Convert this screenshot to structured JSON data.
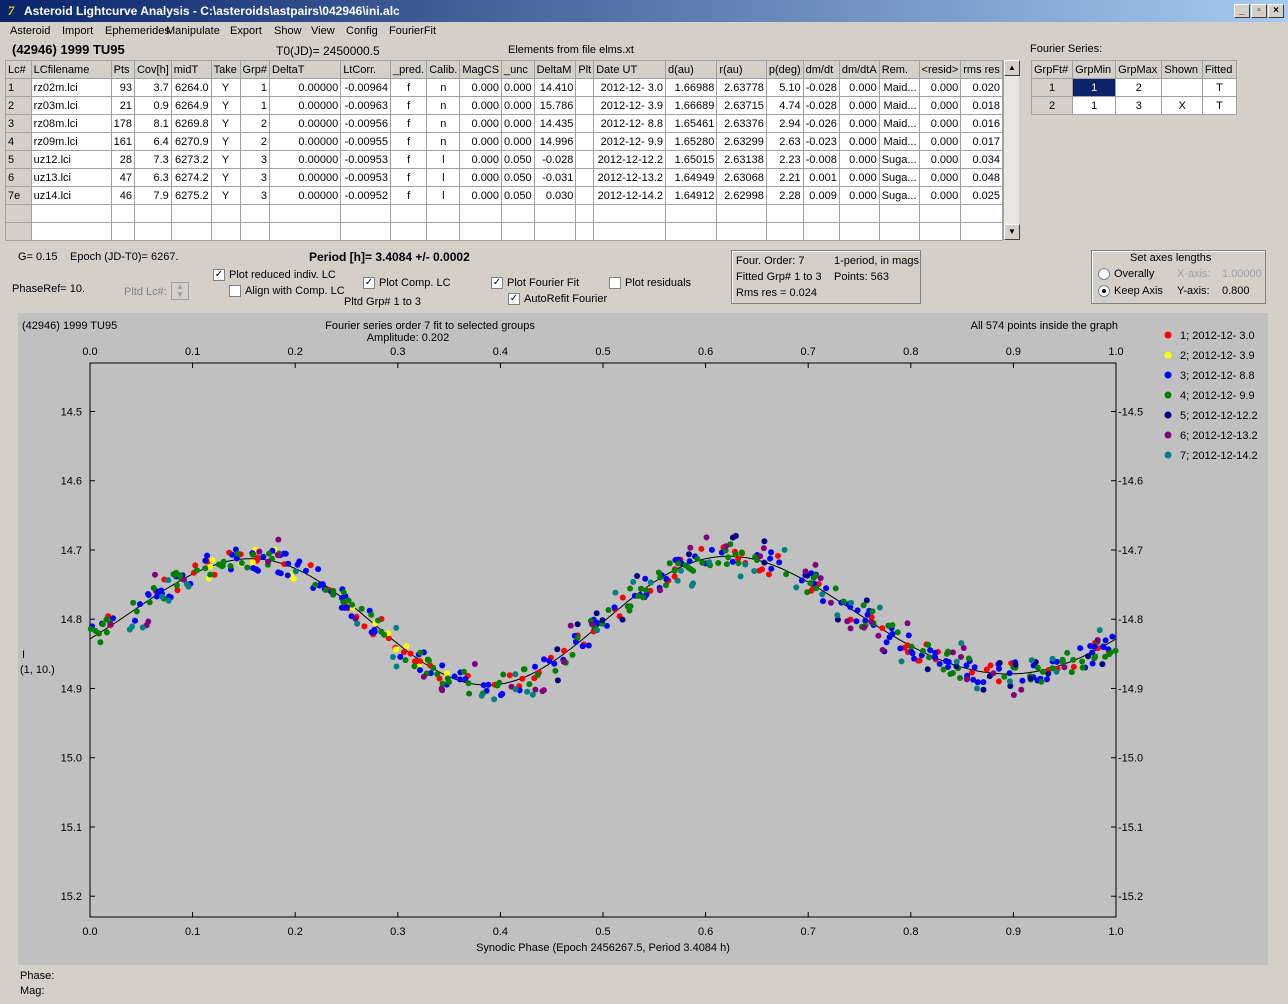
{
  "window": {
    "title": "Asteroid Lightcurve Analysis - C:\\asteroids\\astpairs\\042946\\ini.alc",
    "min": "_",
    "max": "▫",
    "close": "×",
    "app_icon": "7"
  },
  "menu": [
    "Asteroid",
    "Import",
    "Ephemerides",
    "Manipulate",
    "Export",
    "Show",
    "View",
    "Config",
    "FourierFit"
  ],
  "header": {
    "object": "(42946) 1999 TU95",
    "t0": "T0(JD)= 2450000.5",
    "elements": "Elements from file elms.xt",
    "fourier_label": "Fourier Series:"
  },
  "lc_table": {
    "columns": [
      "Lc#",
      "LCfilename",
      "Pts",
      "Cov[h]",
      "midT",
      "Take",
      "Grp#",
      "DeltaT",
      "LtCorr.",
      "_pred.",
      "Calib.",
      "MagCS",
      "_unc",
      "DeltaM",
      "Plt",
      "Date UT",
      "d(au)",
      "r(au)",
      "p(deg)",
      "dm/dt",
      "dm/dtA",
      "Rem.",
      "<resid>",
      "rms res"
    ],
    "rows": [
      [
        "1",
        "rz02m.lci",
        "93",
        "3.7",
        "6264.0",
        "Y",
        "1",
        "0.00000",
        "-0.00964",
        "f",
        "n",
        "0.000",
        "0.000",
        "14.410",
        "",
        "2012-12- 3.0",
        "1.66988",
        "2.63778",
        "5.10",
        "-0.028",
        "0.000",
        "Maid...",
        "0.000",
        "0.020"
      ],
      [
        "2",
        "rz03m.lci",
        "21",
        "0.9",
        "6264.9",
        "Y",
        "1",
        "0.00000",
        "-0.00963",
        "f",
        "n",
        "0.000",
        "0.000",
        "15.786",
        "",
        "2012-12- 3.9",
        "1.66689",
        "2.63715",
        "4.74",
        "-0.028",
        "0.000",
        "Maid...",
        "0.000",
        "0.018"
      ],
      [
        "3",
        "rz08m.lci",
        "178",
        "8.1",
        "6269.8",
        "Y",
        "2",
        "0.00000",
        "-0.00956",
        "f",
        "n",
        "0.000",
        "0.000",
        "14.435",
        "",
        "2012-12- 8.8",
        "1.65461",
        "2.63376",
        "2.94",
        "-0.026",
        "0.000",
        "Maid...",
        "0.000",
        "0.016"
      ],
      [
        "4",
        "rz09m.lci",
        "161",
        "6.4",
        "6270.9",
        "Y",
        "2",
        "0.00000",
        "-0.00955",
        "f",
        "n",
        "0.000",
        "0.000",
        "14.996",
        "",
        "2012-12- 9.9",
        "1.65280",
        "2.63299",
        "2.63",
        "-0.023",
        "0.000",
        "Maid...",
        "0.000",
        "0.017"
      ],
      [
        "5",
        "uz12.lci",
        "28",
        "7.3",
        "6273.2",
        "Y",
        "3",
        "0.00000",
        "-0.00953",
        "f",
        "l",
        "0.000",
        "0.050",
        "-0.028",
        "",
        "2012-12-12.2",
        "1.65015",
        "2.63138",
        "2.23",
        "-0.008",
        "0.000",
        "Suga...",
        "0.000",
        "0.034"
      ],
      [
        "6",
        "uz13.lci",
        "47",
        "6.3",
        "6274.2",
        "Y",
        "3",
        "0.00000",
        "-0.00953",
        "f",
        "l",
        "0.000",
        "0.050",
        "-0.031",
        "",
        "2012-12-13.2",
        "1.64949",
        "2.63068",
        "2.21",
        "0.001",
        "0.000",
        "Suga...",
        "0.000",
        "0.048"
      ],
      [
        "7e",
        "uz14.lci",
        "46",
        "7.9",
        "6275.2",
        "Y",
        "3",
        "0.00000",
        "-0.00952",
        "f",
        "l",
        "0.000",
        "0.050",
        "0.030",
        "",
        "2012-12-14.2",
        "1.64912",
        "2.62998",
        "2.28",
        "0.009",
        "0.000",
        "Suga...",
        "0.000",
        "0.025"
      ]
    ]
  },
  "fourier_table": {
    "columns": [
      "GrpFt#",
      "GrpMin",
      "GrpMax",
      "Shown",
      "Fitted"
    ],
    "rows": [
      [
        "1",
        "1",
        "2",
        "",
        "T"
      ],
      [
        "2",
        "1",
        "3",
        "X",
        "T"
      ]
    ]
  },
  "controls": {
    "g": "G= 0.15",
    "epoch": "Epoch (JD-T0)= 6267.",
    "period": "Period [h]= 3.4084 +/- 0.0002",
    "phaseref": "PhaseRef= 10.",
    "pltd_lc": "Pltd Lc#:",
    "plot_reduced": "Plot reduced indiv. LC",
    "align_comp": "Align with Comp. LC",
    "plot_comp": "Plot Comp. LC",
    "pltd_grp": "Pltd Grp#  1   to   3",
    "plot_fourier": "Plot Fourier Fit",
    "autorefit": "AutoRefit Fourier",
    "plot_residuals": "Plot residuals",
    "check_on": "✓",
    "info": {
      "order": "Four. Order:  7",
      "mode": "1-period, in mags",
      "fitted": "Fitted Grp# 1 to 3",
      "points": "Points: 563",
      "rms": "Rms res     = 0.024"
    },
    "axes": {
      "title": "Set axes lengths",
      "overally": "Overally",
      "keep": "Keep Axis",
      "xlabel": "X-axis:",
      "xval": "1.00000",
      "ylabel": "Y-axis:",
      "yval": "0.800"
    }
  },
  "chart_data": {
    "type": "scatter",
    "title": "(42946) 1999 TU95",
    "subtitle": "Fourier series order 7 fit to selected groups",
    "amplitude": "Amplitude: 0.202",
    "note": "All 574 points inside the graph",
    "xlabel": "Synodic Phase (Epoch 2456267.5, Period 3.4084 h)",
    "ylabel": "I",
    "ylabel2": "(1, 10.)",
    "xlim": [
      0,
      1.0
    ],
    "ylim": [
      15.23,
      14.43
    ],
    "xticks": [
      "0.0",
      "0.1",
      "0.2",
      "0.3",
      "0.4",
      "0.5",
      "0.6",
      "0.7",
      "0.8",
      "0.9",
      "1.0"
    ],
    "yticks": [
      "14.5",
      "14.6",
      "14.7",
      "14.8",
      "14.9",
      "15.0",
      "15.1",
      "15.2"
    ],
    "fit_curve": {
      "mean": 14.8,
      "a1": 0.005,
      "b1": 0.0,
      "a2": 0.085,
      "b2": 0.02,
      "comment_free": true
    },
    "series": [
      {
        "name": "1; 2012-12- 3.0",
        "color": "#ff0000",
        "phase_range": [
          0.0,
          1.0
        ]
      },
      {
        "name": "2; 2012-12- 3.9",
        "color": "#ffff00",
        "phase_range": [
          0.1,
          0.35
        ]
      },
      {
        "name": "3; 2012-12- 8.8",
        "color": "#0000ff",
        "phase_range": [
          0.0,
          1.0
        ]
      },
      {
        "name": "4; 2012-12- 9.9",
        "color": "#008000",
        "phase_range": [
          0.0,
          1.0
        ]
      },
      {
        "name": "5; 2012-12-12.2",
        "color": "#000080",
        "phase_range": [
          0.45,
          1.0
        ]
      },
      {
        "name": "6; 2012-12-13.2",
        "color": "#800080",
        "phase_range": [
          0.0,
          1.0
        ]
      },
      {
        "name": "7; 2012-12-14.2",
        "color": "#008080",
        "phase_range": [
          0.0,
          1.0
        ]
      }
    ]
  },
  "status": {
    "phase": "Phase:",
    "mag": "Mag:"
  }
}
